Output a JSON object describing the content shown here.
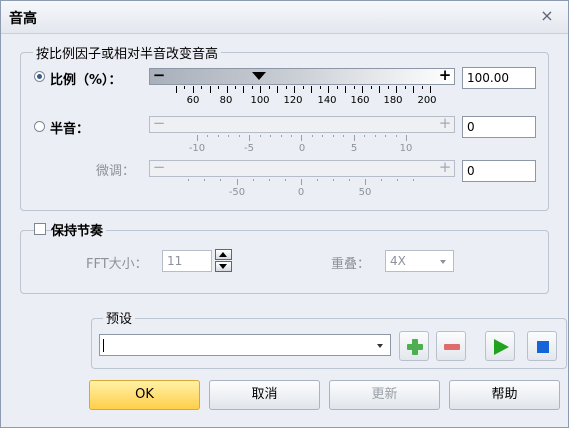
{
  "dialog": {
    "title": "音高",
    "close_glyph": "×"
  },
  "pitch_group": {
    "legend": "按比例因子或相对半音改变音高",
    "ratio": {
      "label": "比例（%）：",
      "selected": true,
      "minus": "−",
      "plus": "+",
      "value": "100.00",
      "slider_value": 100,
      "range": [
        50,
        210
      ],
      "ticks": [
        "60",
        "80",
        "100",
        "120",
        "140",
        "160",
        "180",
        "200"
      ]
    },
    "semitone": {
      "label": "半音：",
      "selected": false,
      "minus": "−",
      "plus": "+",
      "value": "0",
      "ticks": [
        "-10",
        "-5",
        "0",
        "5",
        "10"
      ]
    },
    "finetune": {
      "label": "微调：",
      "minus": "−",
      "plus": "+",
      "value": "0",
      "ticks": [
        "-50",
        "0",
        "50"
      ]
    }
  },
  "keep_tempo": {
    "label": "保持节奏",
    "checked": false,
    "fft_label": "FFT大小：",
    "fft_value": "11",
    "overlap_label": "重叠：",
    "overlap_value": "4X"
  },
  "preset": {
    "legend": "预设",
    "value": "",
    "add_icon": "plus-icon",
    "remove_icon": "minus-icon",
    "play_icon": "play-icon",
    "stop_icon": "stop-icon"
  },
  "buttons": {
    "ok": "OK",
    "cancel": "取消",
    "update": "更新",
    "help": "帮助"
  },
  "colors": {
    "ok_button": "#ffd966",
    "add_green": "#4caf50",
    "remove_red": "#e06b6b",
    "play_green": "#1fa31f",
    "stop_blue": "#1565d8"
  }
}
